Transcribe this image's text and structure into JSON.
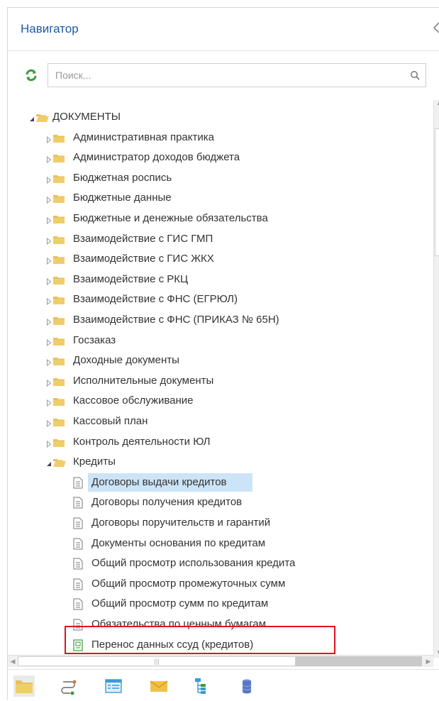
{
  "header": {
    "title": "Навигатор"
  },
  "search": {
    "placeholder": "Поиск..."
  },
  "tree": {
    "root_label": "ДОКУМЕНТЫ",
    "folders": [
      "Административная практика",
      "Администратор доходов бюджета",
      "Бюджетная роспись",
      "Бюджетные данные",
      "Бюджетные и денежные обязательства",
      "Взаимодействие с ГИС ГМП",
      "Взаимодействие с ГИС ЖКХ",
      "Взаимодействие с РКЦ",
      "Взаимодействие с ФНС (ЕГРЮЛ)",
      "Взаимодействие с ФНС (ПРИКАЗ № 65Н)",
      "Госзаказ",
      "Доходные документы",
      "Исполнительные документы",
      "Кассовое обслуживание",
      "Кассовый план",
      "Контроль деятельности ЮЛ"
    ],
    "expanded_folder": "Кредиты",
    "documents": [
      "Договоры выдачи кредитов",
      "Договоры получения кредитов",
      "Договоры поручительств и гарантий",
      "Документы основания по кредитам",
      "Общий просмотр использования кредита",
      "Общий просмотр промежуточных сумм",
      "Общий просмотр сумм по кредитам",
      "Обязательства по ценным бумагам",
      "Перенос данных ссуд (кредитов)"
    ],
    "selected_document": "Договоры выдачи кредитов",
    "highlighted_document": "Перенос данных ссуд (кредитов)"
  },
  "bottom_tabs": [
    {
      "icon": "folder-icon",
      "active": true
    },
    {
      "icon": "workflow-icon",
      "active": false
    },
    {
      "icon": "list-window-icon",
      "active": false
    },
    {
      "icon": "mail-icon",
      "active": false
    },
    {
      "icon": "tree-structure-icon",
      "active": false
    },
    {
      "icon": "database-icon",
      "active": false
    }
  ],
  "colors": {
    "title": "#1c5aa6",
    "folder": "#e8c15a",
    "selection": "#cce4f7",
    "highlight_border": "#e0141e",
    "refresh": "#3c9a3c"
  }
}
